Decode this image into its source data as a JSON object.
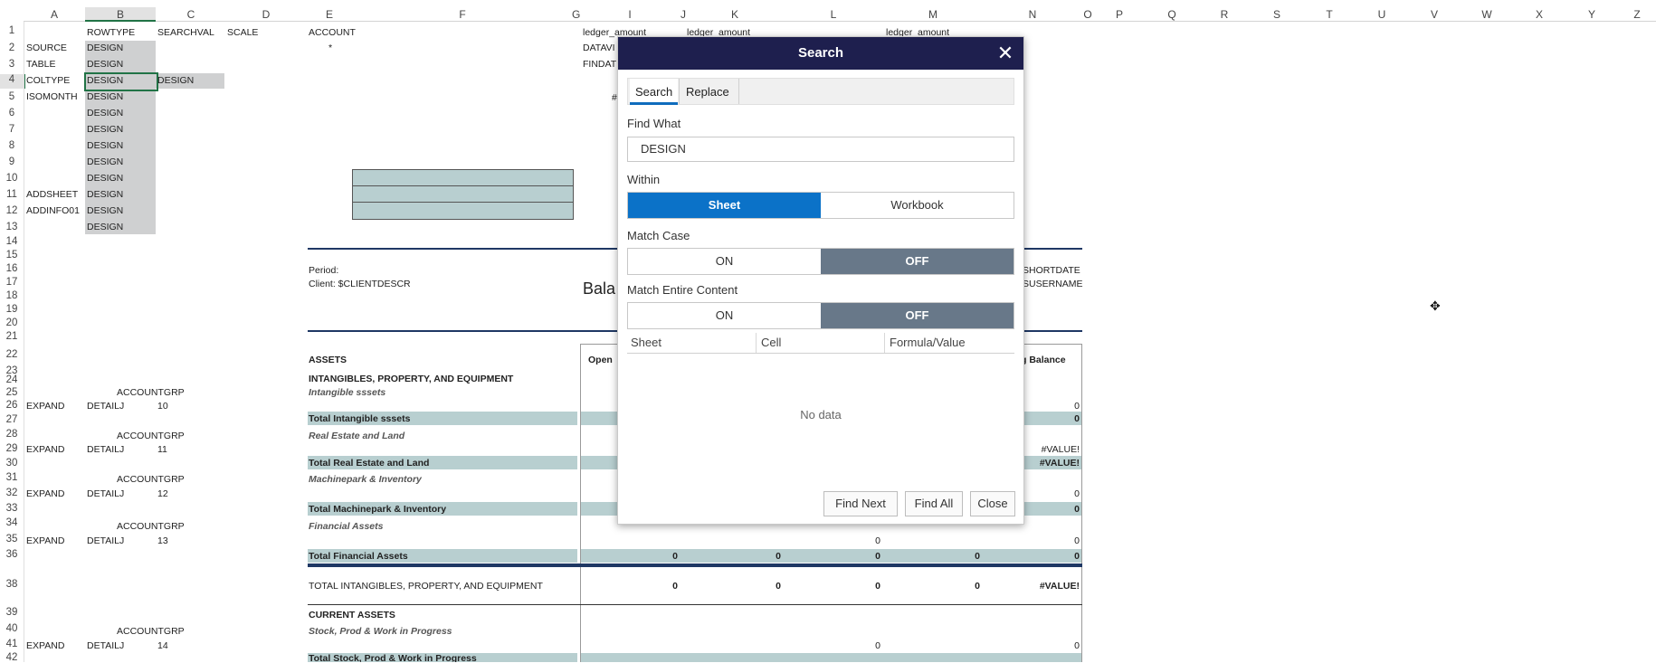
{
  "columns": [
    "A",
    "B",
    "C",
    "D",
    "E",
    "F",
    "G",
    "I",
    "J",
    "K",
    "L",
    "M",
    "N",
    "O",
    "P",
    "Q",
    "R",
    "S",
    "T",
    "U",
    "V",
    "W",
    "X",
    "Y",
    "Z"
  ],
  "rows": [
    "1",
    "2",
    "3",
    "4",
    "5",
    "6",
    "7",
    "8",
    "9",
    "10",
    "11",
    "12",
    "13",
    "14",
    "15",
    "16",
    "17",
    "18",
    "19",
    "20",
    "21",
    "22",
    "23",
    "24",
    "25",
    "26",
    "27",
    "28",
    "29",
    "30",
    "31",
    "32",
    "33",
    "34",
    "35",
    "36",
    "38",
    "39",
    "40",
    "41",
    "42"
  ],
  "sheet": {
    "row1": [
      "ROWTYPE",
      "SEARCHVAL",
      "SCALE",
      "ACCOUNT",
      "ledger_amount",
      "ledger_amount",
      "ledger_amount"
    ],
    "colA": [
      "SOURCE",
      "TABLE",
      "COLTYPE",
      "ISOMONTH",
      "ADDSHEET",
      "ADDINFO01"
    ],
    "design": "DESIGN",
    "star": "*",
    "datavi": "DATAVI",
    "findat": "FINDAT",
    "hash": "#",
    "period": "Period:",
    "client": "Client: $CLIENTDESCR",
    "bala": "Bala",
    "shortdate": "SHORTDATE",
    "username": "SUSERNAME",
    "assets": "ASSETS",
    "open": "Open",
    "endbal": "g Balance",
    "intangibles": "INTANGIBLES, PROPERTY, AND EQUIPMENT",
    "intangible_assets": "Intangible sssets",
    "total_intangible": "Total Intangible sssets",
    "real_estate": "Real Estate and Land",
    "total_real_estate": "Total Real Estate and Land",
    "machinepark": "Machinepark & Inventory",
    "total_machinepark": "Total Machinepark & Inventory",
    "financial": "Financial Assets",
    "total_financial": "Total Financial Assets",
    "total_intangibles_all": "TOTAL INTANGIBLES, PROPERTY, AND EQUIPMENT",
    "current_assets": "CURRENT ASSETS",
    "stock": "Stock, Prod & Work in Progress",
    "total_stock": "Total Stock, Prod & Work in Progress",
    "accountgrp": "ACCOUNTGRP",
    "expand": "EXPAND",
    "detailj": "DETAILJ",
    "codes": [
      "10",
      "11",
      "12",
      "13",
      "14"
    ],
    "zero": "0",
    "value_err": "#VALUE!"
  },
  "dialog": {
    "title": "Search",
    "tabs": [
      "Search",
      "Replace"
    ],
    "find_what_label": "Find What",
    "find_what_value": "DESIGN",
    "within_label": "Within",
    "within_options": [
      "Sheet",
      "Workbook"
    ],
    "match_case_label": "Match Case",
    "match_entire_label": "Match Entire Content",
    "on_label": "ON",
    "off_label": "OFF",
    "grid_headers": [
      "Sheet",
      "Cell",
      "Formula/Value"
    ],
    "no_data": "No data",
    "buttons": [
      "Find Next",
      "Find All",
      "Close"
    ],
    "accent_color": "#0b72c8",
    "title_bar_color": "#1e1f4e"
  }
}
